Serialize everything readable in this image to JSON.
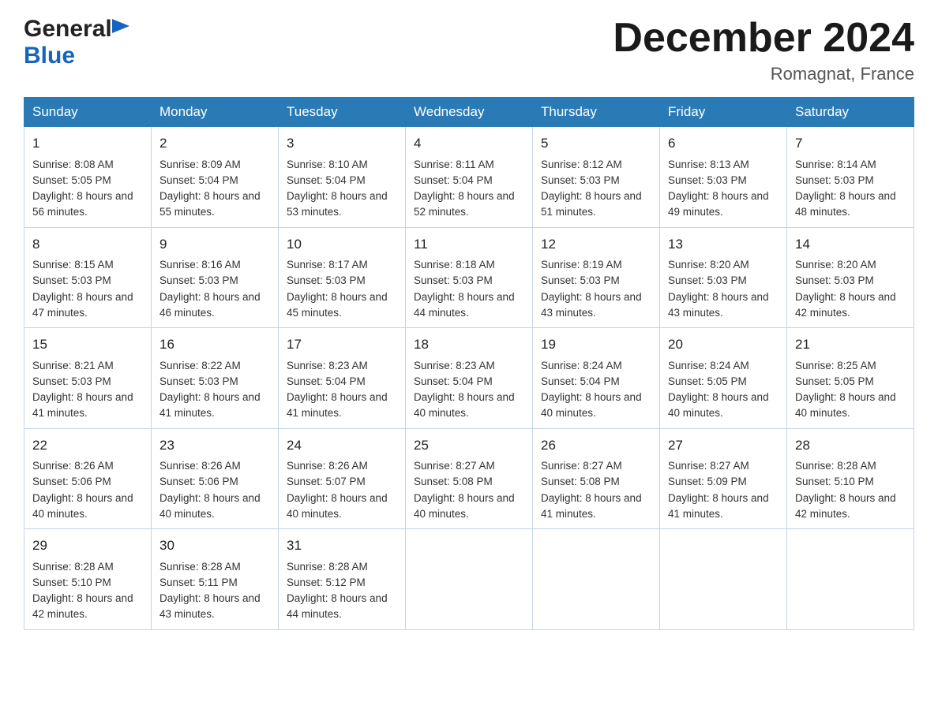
{
  "header": {
    "logo_general": "General",
    "logo_blue": "Blue",
    "month_title": "December 2024",
    "location": "Romagnat, France"
  },
  "days_of_week": [
    "Sunday",
    "Monday",
    "Tuesday",
    "Wednesday",
    "Thursday",
    "Friday",
    "Saturday"
  ],
  "weeks": [
    [
      {
        "day": "1",
        "sunrise": "8:08 AM",
        "sunset": "5:05 PM",
        "daylight": "8 hours and 56 minutes."
      },
      {
        "day": "2",
        "sunrise": "8:09 AM",
        "sunset": "5:04 PM",
        "daylight": "8 hours and 55 minutes."
      },
      {
        "day": "3",
        "sunrise": "8:10 AM",
        "sunset": "5:04 PM",
        "daylight": "8 hours and 53 minutes."
      },
      {
        "day": "4",
        "sunrise": "8:11 AM",
        "sunset": "5:04 PM",
        "daylight": "8 hours and 52 minutes."
      },
      {
        "day": "5",
        "sunrise": "8:12 AM",
        "sunset": "5:03 PM",
        "daylight": "8 hours and 51 minutes."
      },
      {
        "day": "6",
        "sunrise": "8:13 AM",
        "sunset": "5:03 PM",
        "daylight": "8 hours and 49 minutes."
      },
      {
        "day": "7",
        "sunrise": "8:14 AM",
        "sunset": "5:03 PM",
        "daylight": "8 hours and 48 minutes."
      }
    ],
    [
      {
        "day": "8",
        "sunrise": "8:15 AM",
        "sunset": "5:03 PM",
        "daylight": "8 hours and 47 minutes."
      },
      {
        "day": "9",
        "sunrise": "8:16 AM",
        "sunset": "5:03 PM",
        "daylight": "8 hours and 46 minutes."
      },
      {
        "day": "10",
        "sunrise": "8:17 AM",
        "sunset": "5:03 PM",
        "daylight": "8 hours and 45 minutes."
      },
      {
        "day": "11",
        "sunrise": "8:18 AM",
        "sunset": "5:03 PM",
        "daylight": "8 hours and 44 minutes."
      },
      {
        "day": "12",
        "sunrise": "8:19 AM",
        "sunset": "5:03 PM",
        "daylight": "8 hours and 43 minutes."
      },
      {
        "day": "13",
        "sunrise": "8:20 AM",
        "sunset": "5:03 PM",
        "daylight": "8 hours and 43 minutes."
      },
      {
        "day": "14",
        "sunrise": "8:20 AM",
        "sunset": "5:03 PM",
        "daylight": "8 hours and 42 minutes."
      }
    ],
    [
      {
        "day": "15",
        "sunrise": "8:21 AM",
        "sunset": "5:03 PM",
        "daylight": "8 hours and 41 minutes."
      },
      {
        "day": "16",
        "sunrise": "8:22 AM",
        "sunset": "5:03 PM",
        "daylight": "8 hours and 41 minutes."
      },
      {
        "day": "17",
        "sunrise": "8:23 AM",
        "sunset": "5:04 PM",
        "daylight": "8 hours and 41 minutes."
      },
      {
        "day": "18",
        "sunrise": "8:23 AM",
        "sunset": "5:04 PM",
        "daylight": "8 hours and 40 minutes."
      },
      {
        "day": "19",
        "sunrise": "8:24 AM",
        "sunset": "5:04 PM",
        "daylight": "8 hours and 40 minutes."
      },
      {
        "day": "20",
        "sunrise": "8:24 AM",
        "sunset": "5:05 PM",
        "daylight": "8 hours and 40 minutes."
      },
      {
        "day": "21",
        "sunrise": "8:25 AM",
        "sunset": "5:05 PM",
        "daylight": "8 hours and 40 minutes."
      }
    ],
    [
      {
        "day": "22",
        "sunrise": "8:26 AM",
        "sunset": "5:06 PM",
        "daylight": "8 hours and 40 minutes."
      },
      {
        "day": "23",
        "sunrise": "8:26 AM",
        "sunset": "5:06 PM",
        "daylight": "8 hours and 40 minutes."
      },
      {
        "day": "24",
        "sunrise": "8:26 AM",
        "sunset": "5:07 PM",
        "daylight": "8 hours and 40 minutes."
      },
      {
        "day": "25",
        "sunrise": "8:27 AM",
        "sunset": "5:08 PM",
        "daylight": "8 hours and 40 minutes."
      },
      {
        "day": "26",
        "sunrise": "8:27 AM",
        "sunset": "5:08 PM",
        "daylight": "8 hours and 41 minutes."
      },
      {
        "day": "27",
        "sunrise": "8:27 AM",
        "sunset": "5:09 PM",
        "daylight": "8 hours and 41 minutes."
      },
      {
        "day": "28",
        "sunrise": "8:28 AM",
        "sunset": "5:10 PM",
        "daylight": "8 hours and 42 minutes."
      }
    ],
    [
      {
        "day": "29",
        "sunrise": "8:28 AM",
        "sunset": "5:10 PM",
        "daylight": "8 hours and 42 minutes."
      },
      {
        "day": "30",
        "sunrise": "8:28 AM",
        "sunset": "5:11 PM",
        "daylight": "8 hours and 43 minutes."
      },
      {
        "day": "31",
        "sunrise": "8:28 AM",
        "sunset": "5:12 PM",
        "daylight": "8 hours and 44 minutes."
      },
      null,
      null,
      null,
      null
    ]
  ],
  "labels": {
    "sunrise_prefix": "Sunrise: ",
    "sunset_prefix": "Sunset: ",
    "daylight_prefix": "Daylight: "
  }
}
